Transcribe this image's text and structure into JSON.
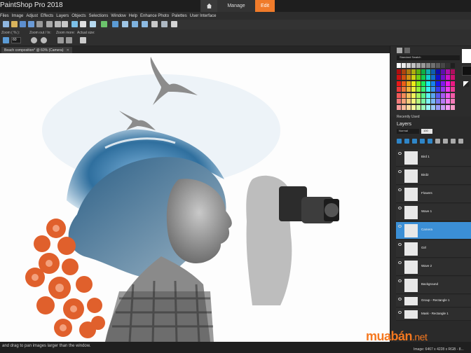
{
  "app": {
    "title": "PaintShop Pro 2018"
  },
  "workspace_tabs": {
    "manage": "Manage",
    "edit": "Edit"
  },
  "menu": [
    "Files",
    "Image",
    "Adjust",
    "Effects",
    "Layers",
    "Objects",
    "Selections",
    "Window",
    "Help",
    "Enhance Photo",
    "Palettes",
    "User Interface"
  ],
  "tool_options": {
    "zoom_label": "Zoom ( % ):",
    "zoom_value": "60",
    "zoom_in_out_label": "Zoom out / In:",
    "zoom_more_label": "Zoom more:",
    "actual_size_label": "Actual size:"
  },
  "document": {
    "tab_label": "Beach composition* @  60% (Camera)"
  },
  "palettes": {
    "materials_label": "Standard Swatch",
    "recently_used_label": "Recently Used",
    "layers_title": "Layers",
    "blend_mode": "Normal",
    "opacity": "100"
  },
  "layers": [
    {
      "name": "Bird 1",
      "selected": false
    },
    {
      "name": "Bird2",
      "selected": false
    },
    {
      "name": "Flowers",
      "selected": false
    },
    {
      "name": "Wave 1",
      "selected": false
    },
    {
      "name": "Camera",
      "selected": true
    },
    {
      "name": "Girl",
      "selected": false
    },
    {
      "name": "Wave 2",
      "selected": false
    },
    {
      "name": "Background",
      "selected": false
    },
    {
      "name": "Group - Rectangle 1",
      "selected": false
    },
    {
      "name": "Mask - Rectangle 1",
      "selected": false
    }
  ],
  "status": {
    "hint": "and drag to pan images larger than the window.",
    "image_info": "Image: 6467 x 4228 x RGB - 8..."
  },
  "watermark": {
    "brand": "muabán",
    "tld": ".net"
  },
  "colors": {
    "accent": "#f07b2a",
    "selection": "#3b8fd6"
  }
}
